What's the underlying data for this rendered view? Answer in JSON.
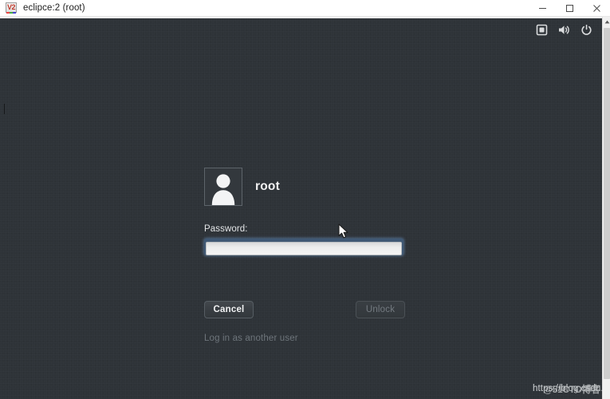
{
  "window": {
    "title": "eclipce:2 (root)",
    "app_icon": "vnc-viewer-icon",
    "controls": {
      "minimize": "minimize-button",
      "maximize": "maximize-button",
      "close": "close-button"
    }
  },
  "sysbar": {
    "items": [
      {
        "name": "accessibility-icon",
        "label": "Accessibility"
      },
      {
        "name": "volume-icon",
        "label": "Volume"
      },
      {
        "name": "power-icon",
        "label": "Power"
      }
    ]
  },
  "lockscreen": {
    "avatar_alt": "root user avatar",
    "username": "root",
    "password_label": "Password:",
    "password_value": "",
    "password_placeholder": "",
    "cancel_label": "Cancel",
    "unlock_label": "Unlock",
    "unlock_disabled": true,
    "other_user_label": "Log in as another user",
    "background_color": "#2e3338",
    "accent_focus_color": "#3f5874"
  },
  "watermark": {
    "url": "https://blog.csdn.n",
    "overlay": "@51CTO博客"
  },
  "scrollbar": {
    "up_arrow": "scroll-up-arrow",
    "thumb": "scrollbar-thumb"
  }
}
